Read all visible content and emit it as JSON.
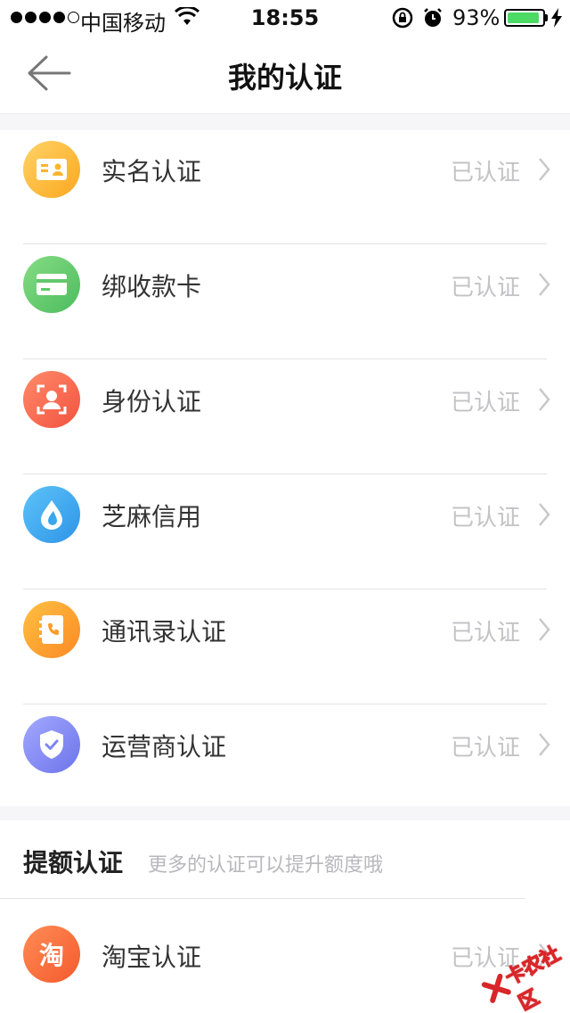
{
  "status_bar": {
    "carrier": "中国移动",
    "time": "18:55",
    "battery_percent": "93%",
    "battery_level": 0.93
  },
  "nav": {
    "title": "我的认证"
  },
  "auth_items": [
    {
      "label": "实名认证",
      "status": "已认证",
      "icon": "id-card-icon",
      "color": "#fbb52c"
    },
    {
      "label": "绑收款卡",
      "status": "已认证",
      "icon": "bank-card-icon",
      "color": "#62c86c"
    },
    {
      "label": "身份认证",
      "status": "已认证",
      "icon": "face-scan-icon",
      "color": "#f8664e"
    },
    {
      "label": "芝麻信用",
      "status": "已认证",
      "icon": "sesame-drop-icon",
      "color": "#3aa6ee"
    },
    {
      "label": "通讯录认证",
      "status": "已认证",
      "icon": "contacts-book-icon",
      "color": "#fd9d2a"
    },
    {
      "label": "运营商认证",
      "status": "已认证",
      "icon": "shield-check-icon",
      "color": "#7f86ef"
    }
  ],
  "quota_section": {
    "title": "提额认证",
    "subtitle": "更多的认证可以提升额度哦",
    "items": [
      {
        "label": "淘宝认证",
        "status": "已认证",
        "icon": "taobao-icon",
        "icon_text": "淘",
        "color": "#fb6a3c"
      }
    ]
  },
  "watermark": {
    "text": "卡农社区"
  }
}
